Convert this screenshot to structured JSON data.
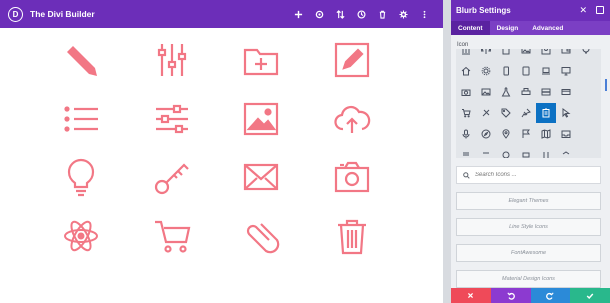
{
  "app": {
    "logo_letter": "D",
    "title": "The Divi Builder"
  },
  "toolbar": {
    "buttons": [
      "add-icon",
      "portability-icon",
      "sort-icon",
      "history-icon",
      "trash-icon",
      "gear-icon",
      "more-icon"
    ]
  },
  "canvas": {
    "icon_color": "#f27785",
    "icons": [
      "pencil-icon",
      "sliders-vertical-icon",
      "folder-add-icon",
      "edit-square-icon",
      "list-icon",
      "sliders-horizontal-icon",
      "image-icon",
      "cloud-upload-icon",
      "lightbulb-icon",
      "key-icon",
      "envelope-icon",
      "camera-icon",
      "atom-icon",
      "cart-icon",
      "paperclip-icon",
      "trash-can-icon"
    ]
  },
  "panel": {
    "title": "Blurb Settings",
    "close_glyph": "✕",
    "tabs": [
      {
        "label": "Content",
        "active": true
      },
      {
        "label": "Design",
        "active": false
      },
      {
        "label": "Advanced",
        "active": false
      }
    ],
    "icon_label": "Icon",
    "search_placeholder": "Search Icons ...",
    "font_sets": [
      "Elegant Themes",
      "Line Style Icons",
      "FontAwesome",
      "Material Design Icons"
    ],
    "selected_icon": "clipboard-icon",
    "footer": [
      {
        "name": "discard-button",
        "color": "#ef4a59"
      },
      {
        "name": "undo-button",
        "color": "#8c3ad0"
      },
      {
        "name": "redo-button",
        "color": "#2b8ad8"
      },
      {
        "name": "save-button",
        "color": "#29b88c"
      }
    ]
  },
  "colors": {
    "brand_purple": "#6c2eb9",
    "accent_pink": "#f27785",
    "selection_blue": "#0c71c3"
  }
}
